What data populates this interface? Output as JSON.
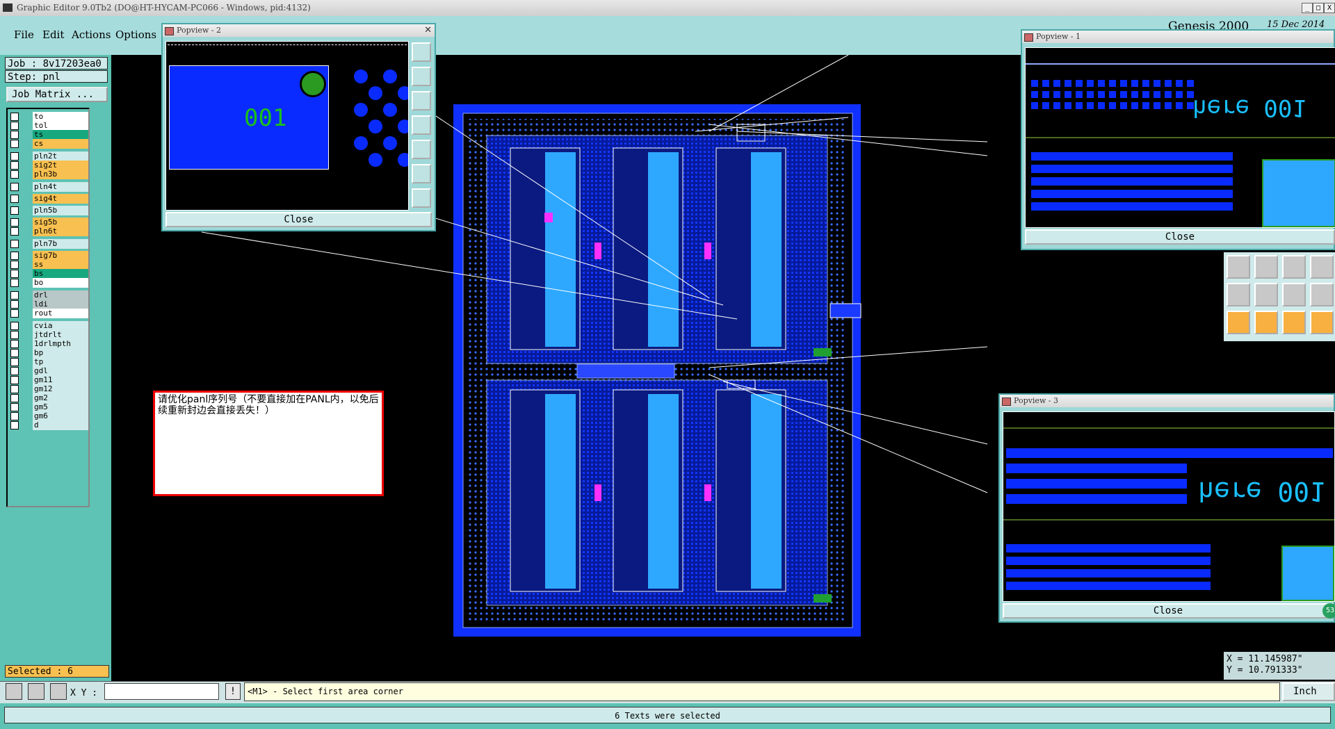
{
  "window": {
    "title": "Graphic Editor 9.0Tb2 (DO@HT-HYCAM-PC066 - Windows, pid:4132)",
    "controls": [
      "_",
      "□",
      "X"
    ]
  },
  "menu": {
    "items": [
      "File",
      "Edit",
      "Actions",
      "Options"
    ]
  },
  "header": {
    "product": "Genesis 2000",
    "date": "15 Dec 2014"
  },
  "job": {
    "job_label": "Job : 8v17203ea0",
    "step_label": "Step: pnl",
    "matrix_button": "Job Matrix ..."
  },
  "layers": [
    {
      "name": "to",
      "color": "#ffffff"
    },
    {
      "name": "tol",
      "color": "#ffffff"
    },
    {
      "name": "ts",
      "color": "#17a880"
    },
    {
      "name": "cs",
      "color": "#f8c050"
    },
    {
      "name": "pln2t",
      "color": "#cfeaea"
    },
    {
      "name": "sig2t",
      "color": "#f8c050"
    },
    {
      "name": "pln3b",
      "color": "#f8c050"
    },
    {
      "name": "pln4t",
      "color": "#cfeaea"
    },
    {
      "name": "sig4t",
      "color": "#f8c050"
    },
    {
      "name": "pln5b",
      "color": "#cfeaea"
    },
    {
      "name": "sig5b",
      "color": "#f8c050"
    },
    {
      "name": "pln6t",
      "color": "#f8c050"
    },
    {
      "name": "pln7b",
      "color": "#cfeaea"
    },
    {
      "name": "sig7b",
      "color": "#f8c050"
    },
    {
      "name": "ss",
      "color": "#f8c050"
    },
    {
      "name": "bs",
      "color": "#17a880"
    },
    {
      "name": "bo",
      "color": "#ffffff"
    },
    {
      "name": "drl",
      "color": "#b8c8c8"
    },
    {
      "name": "ldi",
      "color": "#b8c8c8"
    },
    {
      "name": "rout",
      "color": "#ffffff"
    },
    {
      "name": "cvia",
      "color": "#cfeaea"
    },
    {
      "name": "jtdrlt",
      "color": "#cfeaea"
    },
    {
      "name": "1drlmpth",
      "color": "#cfeaea"
    },
    {
      "name": "bp",
      "color": "#cfeaea"
    },
    {
      "name": "tp",
      "color": "#cfeaea"
    },
    {
      "name": "gdl",
      "color": "#cfeaea"
    },
    {
      "name": "gm11",
      "color": "#cfeaea"
    },
    {
      "name": "gm12",
      "color": "#cfeaea"
    },
    {
      "name": "gm2",
      "color": "#cfeaea"
    },
    {
      "name": "gm5",
      "color": "#cfeaea"
    },
    {
      "name": "gm6",
      "color": "#cfeaea"
    },
    {
      "name": "d",
      "color": "#cfeaea"
    }
  ],
  "selected_label": "Selected : 6",
  "popview1": {
    "title": "Popview - 1",
    "close": "Close",
    "text": "here 001"
  },
  "popview2": {
    "title": "Popview - 2",
    "close": "Close",
    "text": "001"
  },
  "popview3": {
    "title": "Popview - 3",
    "close": "Close",
    "text": "here 001"
  },
  "note": "请优化panl序列号（不要直接加在PANL内，以免后续重新封边会直接丢失！）",
  "coords": {
    "x": "X = 11.145987\"",
    "y": "Y = 10.791333\""
  },
  "command": {
    "xy_label": "X Y :",
    "xy_value": "",
    "bang": "!",
    "prompt": "<M1> - Select first area corner",
    "unit": "Inch"
  },
  "status": "6 Texts were selected",
  "badge": "53",
  "colors": {
    "accent": "#5ec2b4",
    "board": "#0a2bff",
    "panel": "#a7dcdc"
  }
}
